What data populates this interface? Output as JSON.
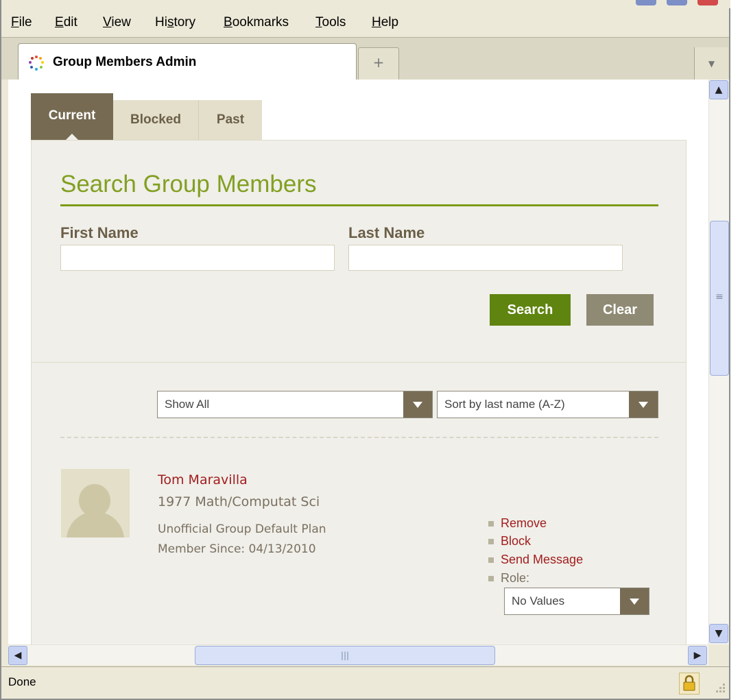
{
  "menu": {
    "items": [
      {
        "key": "F",
        "rest": "ile"
      },
      {
        "key": "E",
        "rest": "dit"
      },
      {
        "key": "V",
        "rest": "iew"
      },
      {
        "pre": "Hi",
        "key": "s",
        "rest": "tory"
      },
      {
        "key": "B",
        "rest": "ookmarks"
      },
      {
        "key": "T",
        "rest": "ools"
      },
      {
        "key": "H",
        "rest": "elp"
      }
    ]
  },
  "browser": {
    "tab_title": "Group Members Admin",
    "new_tab": "+",
    "status": "Done"
  },
  "page": {
    "tabs": [
      "Current",
      "Blocked",
      "Past"
    ],
    "search_title": "Search Group Members",
    "first_name_label": "First Name",
    "last_name_label": "Last Name",
    "first_name_value": "",
    "last_name_value": "",
    "search_button": "Search",
    "clear_button": "Clear",
    "filter_selected": "Show All",
    "sort_selected": "Sort by last name (A-Z)"
  },
  "member": {
    "name": "Tom Maravilla",
    "class_info": "1977 Math/Computat Sci",
    "plan": "Unofficial Group Default Plan",
    "since": "Member Since: 04/13/2010",
    "actions": {
      "remove": "Remove",
      "block": "Block",
      "send_message": "Send Message",
      "role": "Role:"
    },
    "role_selected": "No Values"
  },
  "colors": {
    "accent_green": "#7b9b14",
    "tab_brown": "#766a52",
    "link_red": "#a11d1d"
  },
  "icons": {
    "favicon": "dotted-circle-icon",
    "lock": "padlock-icon",
    "grip": "resize-grip-icon"
  }
}
